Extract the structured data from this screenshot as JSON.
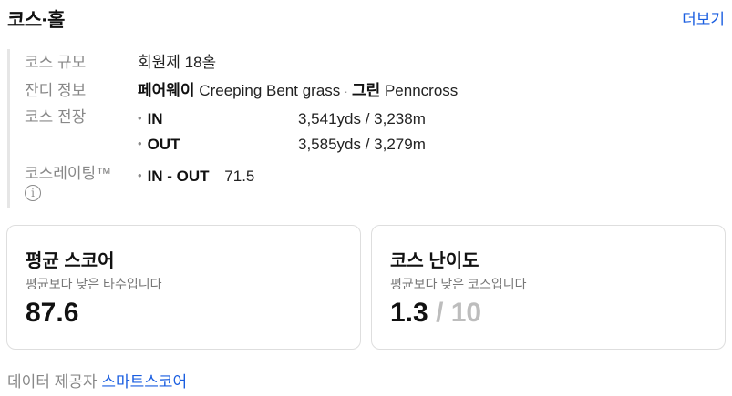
{
  "header": {
    "title": "코스·홀",
    "more_label": "더보기"
  },
  "info": {
    "scale": {
      "label": "코스 규모",
      "value": "회원제 18홀"
    },
    "grass": {
      "label": "잔디 정보",
      "fairway_label": "페어웨이",
      "fairway_value": "Creeping Bent grass",
      "separator": "·",
      "green_label": "그린",
      "green_value": "Penncross"
    },
    "length": {
      "label": "코스 전장",
      "rows": [
        {
          "key": "IN",
          "value": "3,541yds / 3,238m"
        },
        {
          "key": "OUT",
          "value": "3,585yds / 3,279m"
        }
      ]
    },
    "rating": {
      "label": "코스레이팅™",
      "info_icon_glyph": "i",
      "key": "IN - OUT",
      "value": "71.5"
    }
  },
  "cards": {
    "avg_score": {
      "title": "평균 스코어",
      "subtitle": "평균보다 낮은 타수입니다",
      "value": "87.6"
    },
    "difficulty": {
      "title": "코스 난이도",
      "subtitle": "평균보다 낮은 코스입니다",
      "value": "1.3",
      "max": "/ 10"
    }
  },
  "footer": {
    "provider_label": "데이터 제공자",
    "provider_name": "스마트스코어"
  },
  "colors": {
    "link": "#1a5ee0",
    "label_gray": "#888888",
    "muted_value": "#bdbdbd"
  },
  "icons": {
    "info": "info-circle-icon",
    "bullet": "bullet-dot-icon"
  }
}
